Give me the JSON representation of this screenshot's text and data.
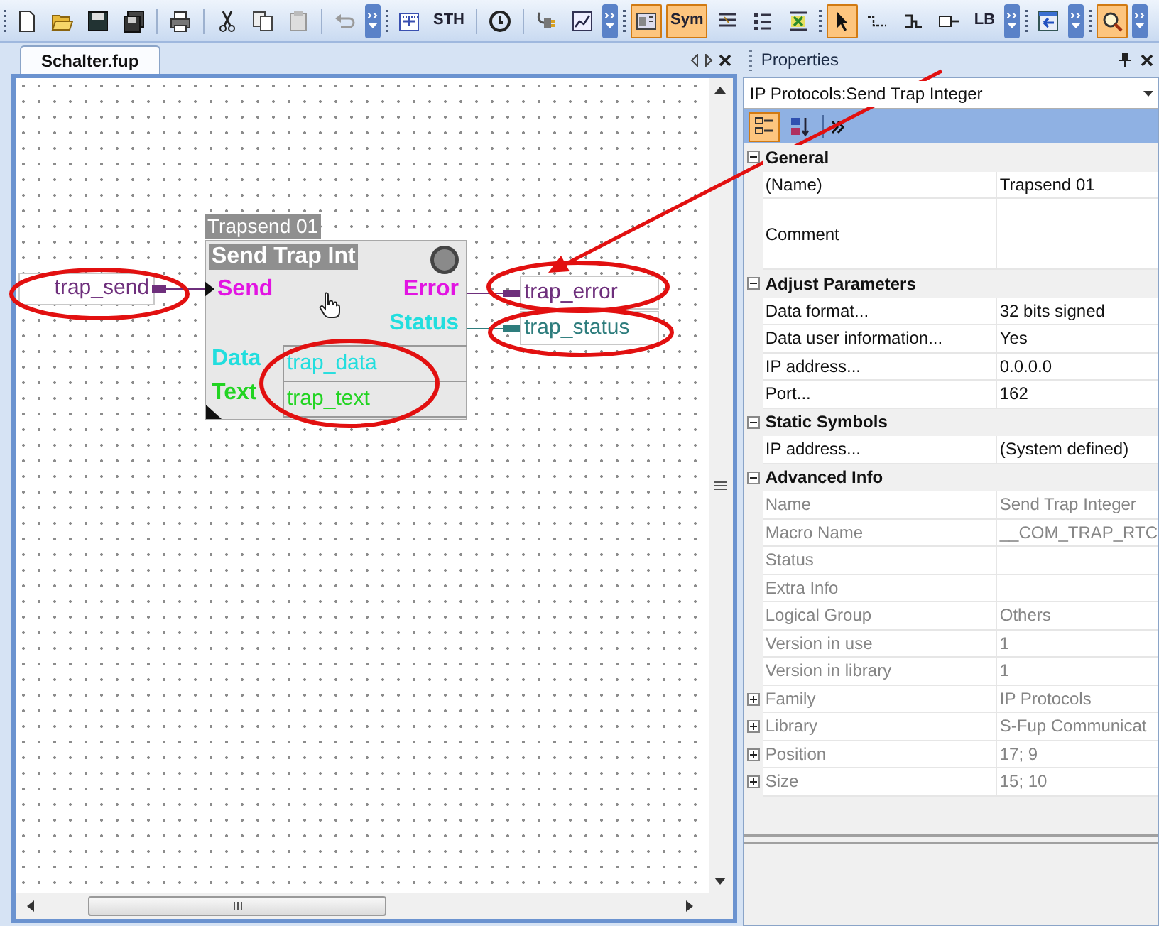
{
  "toolbar": [
    {
      "kind": "grip"
    },
    {
      "kind": "button",
      "selected": false
    },
    {
      "kind": "button",
      "selected": false
    },
    {
      "kind": "button",
      "selected": false
    },
    {
      "kind": "button",
      "selected": false
    },
    {
      "kind": "separator"
    },
    {
      "kind": "button",
      "selected": false
    },
    {
      "kind": "separator"
    },
    {
      "kind": "button",
      "selected": false
    },
    {
      "kind": "button",
      "selected": false
    },
    {
      "kind": "button",
      "selected": false
    },
    {
      "kind": "separator"
    },
    {
      "kind": "button",
      "selected": false
    },
    {
      "kind": "overflow"
    },
    {
      "kind": "grip"
    },
    {
      "kind": "button",
      "selected": false
    },
    {
      "kind": "button",
      "label": "STH",
      "selected": false
    },
    {
      "kind": "separator"
    },
    {
      "kind": "button",
      "selected": false
    },
    {
      "kind": "separator"
    },
    {
      "kind": "button",
      "selected": false
    },
    {
      "kind": "button",
      "selected": false
    },
    {
      "kind": "overflow"
    },
    {
      "kind": "grip"
    },
    {
      "kind": "button",
      "selected": true
    },
    {
      "kind": "button",
      "label": "Sym",
      "selected": true
    },
    {
      "kind": "button",
      "selected": false
    },
    {
      "kind": "button",
      "selected": false
    },
    {
      "kind": "button",
      "selected": false
    },
    {
      "kind": "grip"
    },
    {
      "kind": "button",
      "selected": true
    },
    {
      "kind": "button",
      "selected": false
    },
    {
      "kind": "button",
      "selected": false
    },
    {
      "kind": "button",
      "selected": false
    },
    {
      "kind": "button",
      "label": "LB",
      "selected": false
    },
    {
      "kind": "overflow"
    },
    {
      "kind": "grip"
    },
    {
      "kind": "button",
      "selected": false
    },
    {
      "kind": "overflow"
    },
    {
      "kind": "grip"
    },
    {
      "kind": "button",
      "selected": true
    },
    {
      "kind": "overflow"
    }
  ],
  "document_tab": {
    "label": "Schalter.fup",
    "selected": true
  },
  "diagram": {
    "input_symbols": [
      {
        "label": "trap_send",
        "color": "#6e2f7c"
      }
    ],
    "block": {
      "instance_name": "Trapsend 01",
      "title": "Send Trap Int",
      "inputs": [
        {
          "label": "Send",
          "color": "#e214e2"
        }
      ],
      "outputs": [
        {
          "label": "Error",
          "color": "#e214e2"
        },
        {
          "label": "Status",
          "color": "#22dede"
        }
      ],
      "parameters": [
        {
          "label": "Data",
          "value": "trap_data",
          "color": "#22dede"
        },
        {
          "label": "Text",
          "value": "trap_text",
          "color": "#22d422"
        }
      ]
    },
    "output_symbols": [
      {
        "label": "trap_error",
        "color": "#6e2f7c"
      },
      {
        "label": "trap_status",
        "color": "#2e7d7d"
      }
    ]
  },
  "properties": {
    "title": "Properties",
    "selector": "IP Protocols:Send Trap Integer",
    "view_buttons": [
      {
        "selected": true
      },
      {
        "selected": false
      }
    ],
    "sections": [
      {
        "label": "General",
        "expanded": true,
        "rows": [
          {
            "kind": "text",
            "label": "(Name)",
            "value": "Trapsend 01",
            "disabled": false,
            "expandable": false
          },
          {
            "kind": "multiline",
            "label": "Comment",
            "disabled": false,
            "expandable": false
          }
        ]
      },
      {
        "label": "Adjust Parameters",
        "expanded": true,
        "rows": [
          {
            "kind": "text",
            "label": "Data format...",
            "value": "32 bits signed",
            "disabled": false,
            "expandable": false
          },
          {
            "kind": "text",
            "label": "Data user information...",
            "value": "Yes",
            "disabled": false,
            "expandable": false
          },
          {
            "kind": "text",
            "label": "IP address...",
            "value": "0.0.0.0",
            "disabled": false,
            "expandable": false
          },
          {
            "kind": "text",
            "label": "Port...",
            "value": "162",
            "disabled": false,
            "expandable": false
          }
        ]
      },
      {
        "label": "Static Symbols",
        "expanded": true,
        "rows": [
          {
            "kind": "text",
            "label": "IP address...",
            "value": "(System defined)",
            "disabled": false,
            "expandable": false
          }
        ]
      },
      {
        "label": "Advanced Info",
        "expanded": true,
        "rows": [
          {
            "kind": "text",
            "label": "Name",
            "value": "Send Trap Integer",
            "disabled": true,
            "expandable": false
          },
          {
            "kind": "text",
            "label": "Macro Name",
            "value": "__COM_TRAP_RTC",
            "disabled": true,
            "expandable": false
          },
          {
            "kind": "text",
            "label": "Status",
            "disabled": true,
            "expandable": false
          },
          {
            "kind": "text",
            "label": "Extra Info",
            "disabled": true,
            "expandable": false
          },
          {
            "kind": "text",
            "label": "Logical Group",
            "value": "Others",
            "disabled": true,
            "expandable": false
          },
          {
            "kind": "text",
            "label": "Version in use",
            "value": "1",
            "disabled": true,
            "expandable": false
          },
          {
            "kind": "text",
            "label": "Version in library",
            "value": "1",
            "disabled": true,
            "expandable": false
          },
          {
            "kind": "text",
            "label": "Family",
            "value": "IP Protocols",
            "disabled": true,
            "expandable": true
          },
          {
            "kind": "text",
            "label": "Library",
            "value": "S-Fup Communicat",
            "disabled": true,
            "expandable": true
          },
          {
            "kind": "text",
            "label": "Position",
            "value": "17; 9",
            "disabled": true,
            "expandable": true
          },
          {
            "kind": "text",
            "label": "Size",
            "value": "15; 10",
            "disabled": true,
            "expandable": true
          }
        ]
      }
    ]
  }
}
